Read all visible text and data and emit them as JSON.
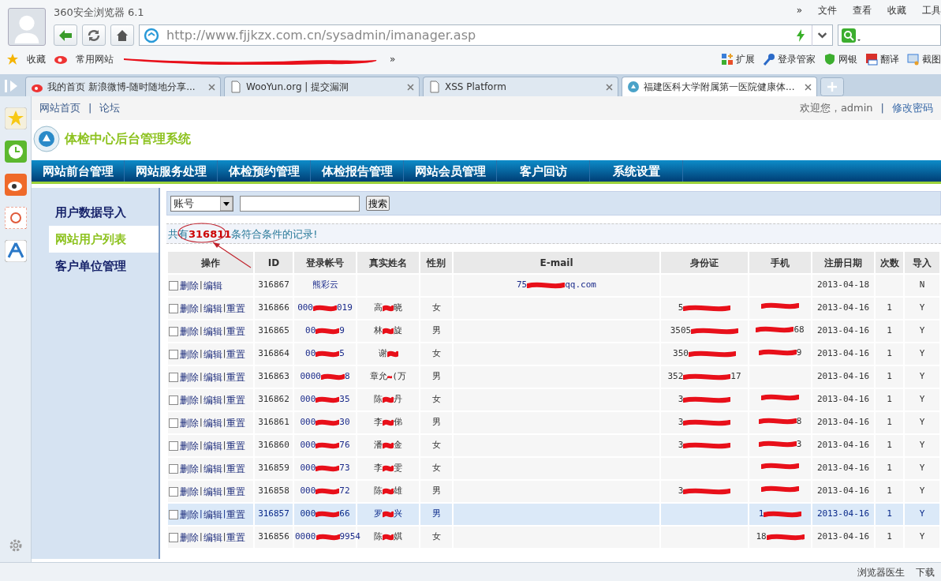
{
  "browser": {
    "title": "360安全浏览器 6.1",
    "menu": [
      "»",
      "文件",
      "查看",
      "收藏",
      "工具"
    ],
    "url": "http://www.fjjkzx.com.cn/sysadmin/imanager.asp",
    "bookmarks": [
      "收藏",
      "常用网站"
    ],
    "bookmarks_more": "»",
    "tools": [
      {
        "label": "扩展",
        "kind": "grid"
      },
      {
        "label": "登录管家",
        "kind": "key"
      },
      {
        "label": "网银",
        "kind": "shield"
      },
      {
        "label": "翻译",
        "kind": "translate"
      },
      {
        "label": "截图",
        "kind": "screen"
      }
    ],
    "tabs": [
      {
        "label": "我的首页 新浪微博-随时随地分享...",
        "kind": "weibo",
        "selected": false
      },
      {
        "label": "WooYun.org | 提交漏洞",
        "kind": "page",
        "selected": false
      },
      {
        "label": "XSS Platform",
        "kind": "page",
        "selected": false
      },
      {
        "label": "福建医科大学附属第一医院健康体...",
        "kind": "globe",
        "selected": true
      }
    ]
  },
  "page": {
    "top_links": [
      "网站首页",
      "论坛"
    ],
    "separator": "|",
    "welcome": "欢迎您，admin",
    "change_password": "修改密码",
    "site_title": "体检中心后台管理系统",
    "nav": [
      "网站前台管理",
      "网站服务处理",
      "体检预约管理",
      "体检报告管理",
      "网站会员管理",
      "客户回访",
      "系统设置"
    ],
    "side_menu": [
      {
        "label": "用户数据导入",
        "selected": false
      },
      {
        "label": "网站用户列表",
        "selected": true
      },
      {
        "label": "客户单位管理",
        "selected": false
      }
    ],
    "search": {
      "field": "账号",
      "button": "搜索"
    },
    "summary": "共有**316811**条符合条件的记录!",
    "table": {
      "columns": [
        "操作",
        "ID",
        "登录帐号",
        "真实姓名",
        "性别",
        "E-mail",
        "身份证",
        "手机",
        "注册日期",
        "次数",
        "导入"
      ],
      "ops_separator": "|",
      "rows": [
        {
          "checked": false,
          "selected": false,
          "ops": [
            "删除",
            "编辑"
          ],
          "id": "316867",
          "account": "熊彩云",
          "email": {
            "head": "75",
            "tail": "qq.com"
          },
          "date": "2013-04-18",
          "import": "N"
        },
        {
          "checked": false,
          "selected": false,
          "ops": [
            "删除",
            "编辑",
            "重置"
          ],
          "id": "316866",
          "account": {
            "head": "000",
            "tail": "019"
          },
          "name": {
            "head": "高",
            "tail": "晓"
          },
          "sex": "女",
          "id_card": {
            "head": "5"
          },
          "phone": {},
          "date": "2013-04-16",
          "count": "1",
          "import": "Y"
        },
        {
          "checked": false,
          "selected": false,
          "ops": [
            "删除",
            "编辑",
            "重置"
          ],
          "id": "316865",
          "account": {
            "head": "00",
            "tail": "9"
          },
          "name": {
            "head": "林",
            "tail": "旋"
          },
          "sex": "男",
          "id_card": {
            "head": "3505"
          },
          "phone": {
            "tail": "68"
          },
          "date": "2013-04-16",
          "count": "1",
          "import": "Y"
        },
        {
          "checked": false,
          "selected": false,
          "ops": [
            "删除",
            "编辑",
            "重置"
          ],
          "id": "316864",
          "account": {
            "head": "00",
            "tail": "5"
          },
          "name": {
            "head": "谢"
          },
          "sex": "女",
          "id_card": {
            "head": "350"
          },
          "phone": {
            "tail": "9"
          },
          "date": "2013-04-16",
          "count": "1",
          "import": "Y"
        },
        {
          "checked": false,
          "selected": false,
          "ops": [
            "删除",
            "编辑",
            "重置"
          ],
          "id": "316863",
          "account": {
            "head": "0000",
            "tail": "8"
          },
          "name": {
            "head": "章允",
            "tail": "(万"
          },
          "sex": "男",
          "id_card": {
            "head": "352",
            "tail": "17"
          },
          "date": "2013-04-16",
          "count": "1",
          "import": "Y"
        },
        {
          "checked": false,
          "selected": false,
          "ops": [
            "删除",
            "编辑",
            "重置"
          ],
          "id": "316862",
          "account": {
            "head": "000",
            "tail": "35"
          },
          "name": {
            "head": "陈",
            "tail": "丹"
          },
          "sex": "女",
          "id_card": {
            "head": "3"
          },
          "phone": {},
          "date": "2013-04-16",
          "count": "1",
          "import": "Y"
        },
        {
          "checked": false,
          "selected": false,
          "ops": [
            "删除",
            "编辑",
            "重置"
          ],
          "id": "316861",
          "account": {
            "head": "000",
            "tail": "30"
          },
          "name": {
            "head": "李",
            "tail": "俤"
          },
          "sex": "男",
          "id_card": {
            "head": "3"
          },
          "phone": {
            "tail": "8"
          },
          "date": "2013-04-16",
          "count": "1",
          "import": "Y"
        },
        {
          "checked": false,
          "selected": false,
          "ops": [
            "删除",
            "编辑",
            "重置"
          ],
          "id": "316860",
          "account": {
            "head": "000",
            "tail": "76"
          },
          "name": {
            "head": "潘",
            "tail": "金"
          },
          "sex": "女",
          "id_card": {
            "head": "3"
          },
          "phone": {
            "tail": "3"
          },
          "date": "2013-04-16",
          "count": "1",
          "import": "Y"
        },
        {
          "checked": false,
          "selected": false,
          "ops": [
            "删除",
            "编辑",
            "重置"
          ],
          "id": "316859",
          "account": {
            "head": "000",
            "tail": "73"
          },
          "name": {
            "head": "李",
            "tail": "雯"
          },
          "sex": "女",
          "phone": {},
          "date": "2013-04-16",
          "count": "1",
          "import": "Y"
        },
        {
          "checked": false,
          "selected": false,
          "ops": [
            "删除",
            "编辑",
            "重置"
          ],
          "id": "316858",
          "account": {
            "head": "000",
            "tail": "72"
          },
          "name": {
            "head": "陈",
            "tail": "雄"
          },
          "sex": "男",
          "id_card": {
            "head": "3"
          },
          "phone": {},
          "date": "2013-04-16",
          "count": "1",
          "import": "Y"
        },
        {
          "checked": false,
          "selected": true,
          "ops": [
            "删除",
            "编辑",
            "重置"
          ],
          "id": "316857",
          "account": {
            "head": "000",
            "tail": "66"
          },
          "name": {
            "head": "罗",
            "tail": "兴"
          },
          "sex": "男",
          "phone": {
            "head": "1"
          },
          "date": "2013-04-16",
          "count": "1",
          "import": "Y"
        },
        {
          "checked": false,
          "selected": false,
          "ops": [
            "删除",
            "编辑",
            "重置"
          ],
          "id": "316856",
          "account": {
            "head": "0000",
            "tail": "9954"
          },
          "name": {
            "head": "陈",
            "tail": "娸"
          },
          "sex": "女",
          "phone": {
            "head": "18"
          },
          "date": "2013-04-16",
          "count": "1",
          "import": "Y"
        }
      ]
    }
  },
  "status_bar": [
    "浏览器医生",
    "下载"
  ]
}
